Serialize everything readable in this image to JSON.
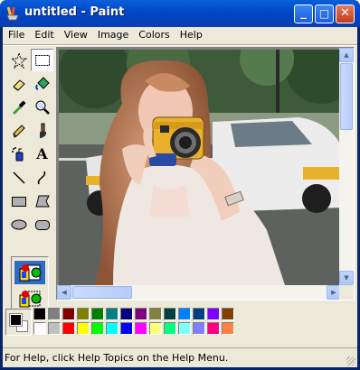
{
  "window": {
    "title": "untitled - Paint",
    "minimize_label": "_",
    "maximize_label": "□",
    "close_label": "✕"
  },
  "menus": [
    {
      "label": "File"
    },
    {
      "label": "Edit"
    },
    {
      "label": "View"
    },
    {
      "label": "Image"
    },
    {
      "label": "Colors"
    },
    {
      "label": "Help"
    }
  ],
  "tools": [
    {
      "name": "free-form-select-tool",
      "icon": "star-dotted"
    },
    {
      "name": "select-tool",
      "icon": "rect-dotted",
      "selected": true
    },
    {
      "name": "eraser-tool",
      "icon": "eraser"
    },
    {
      "name": "fill-tool",
      "icon": "paint-bucket"
    },
    {
      "name": "pick-color-tool",
      "icon": "eyedropper"
    },
    {
      "name": "magnifier-tool",
      "icon": "magnifier"
    },
    {
      "name": "pencil-tool",
      "icon": "pencil"
    },
    {
      "name": "brush-tool",
      "icon": "brush"
    },
    {
      "name": "airbrush-tool",
      "icon": "airbrush"
    },
    {
      "name": "text-tool",
      "icon": "text-A"
    },
    {
      "name": "line-tool",
      "icon": "line"
    },
    {
      "name": "curve-tool",
      "icon": "curve"
    },
    {
      "name": "rectangle-tool",
      "icon": "rectangle"
    },
    {
      "name": "polygon-tool",
      "icon": "polygon"
    },
    {
      "name": "ellipse-tool",
      "icon": "ellipse"
    },
    {
      "name": "rounded-rectangle-tool",
      "icon": "rounded-rect"
    }
  ],
  "tool_options": [
    {
      "name": "opaque-selection-option",
      "selected": true
    },
    {
      "name": "transparent-selection-option",
      "selected": false
    }
  ],
  "colors": {
    "foreground": "#000000",
    "background": "#ffffff",
    "palette_top": [
      "#000000",
      "#808080",
      "#800000",
      "#808000",
      "#008000",
      "#008080",
      "#000080",
      "#800080",
      "#808040",
      "#004040",
      "#0080ff",
      "#004080",
      "#8000ff",
      "#804000"
    ],
    "palette_bottom": [
      "#ffffff",
      "#c0c0c0",
      "#ff0000",
      "#ffff00",
      "#00ff00",
      "#00ffff",
      "#0000ff",
      "#ff00ff",
      "#ffff80",
      "#00ff80",
      "#80ffff",
      "#8080ff",
      "#ff0080",
      "#ff8040"
    ]
  },
  "status": {
    "text": "For Help, click Help Topics on the Help Menu."
  }
}
